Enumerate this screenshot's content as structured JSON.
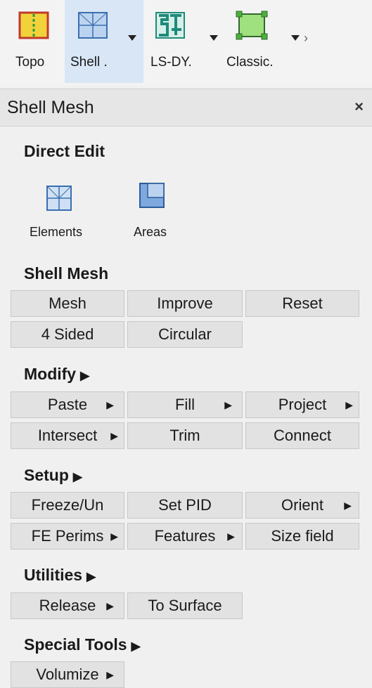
{
  "toolbar": {
    "items": [
      {
        "label": "Topo"
      },
      {
        "label": "Shell ."
      },
      {
        "label": "LS-DY."
      },
      {
        "label": "Classic."
      }
    ],
    "more": "›"
  },
  "panel": {
    "title": "Shell Mesh",
    "close": "×"
  },
  "direct_edit": {
    "title": "Direct Edit",
    "items": [
      {
        "label": "Elements"
      },
      {
        "label": "Areas"
      }
    ]
  },
  "shell_mesh": {
    "title": "Shell Mesh",
    "buttons": [
      "Mesh",
      "Improve",
      "Reset",
      "4 Sided",
      "Circular"
    ]
  },
  "modify": {
    "title": "Modify",
    "buttons": [
      "Paste",
      "Fill",
      "Project",
      "Intersect",
      "Trim",
      "Connect"
    ]
  },
  "setup": {
    "title": "Setup",
    "buttons": [
      "Freeze/Un",
      "Set PID",
      "Orient",
      "FE Perims",
      "Features",
      "Size field"
    ]
  },
  "utilities": {
    "title": "Utilities",
    "buttons": [
      "Release",
      "To Surface"
    ]
  },
  "special_tools": {
    "title": "Special Tools",
    "buttons": [
      "Volumize"
    ]
  },
  "arrow_glyph": "▶",
  "icon_colors": {
    "topo": "#f2d23a",
    "shell": "#3a6fb0",
    "lsdyna": "#1f8a7a",
    "classic": "#4caf3c"
  }
}
